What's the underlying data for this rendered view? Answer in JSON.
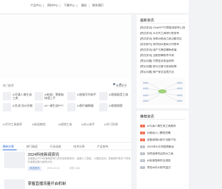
{
  "nav": {
    "items": [
      {
        "label": "产品中心"
      },
      {
        "label": "资料中心"
      },
      {
        "label": "下载中心"
      },
      {
        "label": "服务"
      },
      {
        "label": "联系我们"
      }
    ]
  },
  "main": {
    "hot_title": "热门推荐",
    "more_label": "查看更多",
    "grid": [
      {
        "text": "AI写真人像生成\n工具"
      },
      {
        "text": "AI绘画：零基础\n快速上手"
      },
      {
        "text": "AI智能写作助手"
      },
      {
        "text": "AI智能配音工具"
      },
      {
        "text": "AI生成\n设计灵感"
      },
      {
        "text": "AI一键生成PPT"
      },
      {
        "text": "AI图片编辑器"
      },
      {
        "text": "AI智能搜索"
      }
    ],
    "links": [
      "AI写作工具推荐",
      "AI绘画教程",
      "AI视频工具",
      "AI办公助手",
      "AI学习资源"
    ],
    "tabs": [
      {
        "label": "最新文章"
      },
      {
        "label": "热门阅读"
      },
      {
        "label": "行业动态"
      },
      {
        "label": "技术分享"
      },
      {
        "label": "产品发布"
      }
    ],
    "articles": [
      {
        "title": "2024科技新闻资讯",
        "desc": "全面盘点2024年最具影响力的科技新闻资讯，涵盖人工智能、大模型应用、智能硬件等多个领域的重要进展与趋势分析。",
        "tag": "科技资讯",
        "date": "2024-04-12",
        "views": "浏览 1152"
      },
      {
        "title": "掌握直播流量开启机制",
        "desc": "",
        "tag": "",
        "date": "",
        "views": ""
      }
    ]
  },
  "sidebar": {
    "latest_title": "最新资讯",
    "latest": [
      "[热点资讯] ChatGPT付费版本即将上线",
      "[热点资讯] AI写作工具排行榜发布",
      "[热点资讯] 多款AI绘画工具功能对比",
      "[实用技巧] 如何用AI提高写作效率",
      "[热点资讯] 国产大模型最新进展",
      "[热点资讯] 全能剪辑软件评测",
      "[常见问题] 付费会员权益说明",
      "[常见问题] 账号注册与登录指南",
      "[常见问题] 账户安全设置方法"
    ],
    "rank_title": "推荐资讯",
    "ranks": [
      {
        "num": "1",
        "text": "AI写真人像生成工具推荐"
      },
      {
        "num": "2",
        "text": "AI绘画入门教程合集"
      },
      {
        "num": "3",
        "text": "智能营销AI助手功能介绍"
      },
      {
        "num": "4",
        "text": "2024年AI写作趋势解读"
      },
      {
        "num": "5",
        "text": "如何选择合适的AI工具"
      },
      {
        "num": "6",
        "text": "AI短视频制作全流程"
      },
      {
        "num": "7",
        "text": "常用AI办公软件盘点"
      }
    ]
  }
}
